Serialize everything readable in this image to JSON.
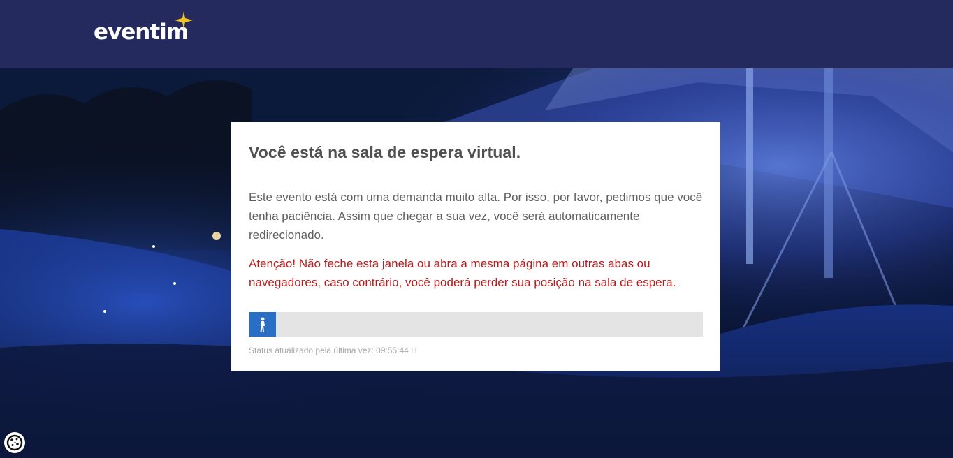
{
  "header": {
    "logo_text": "eventim",
    "background_color": "#242a5e",
    "star_color": "#f3c323"
  },
  "waiting_room": {
    "title": "Você está na sala de espera virtual.",
    "body": "Este evento está com uma demanda muito alta. Por isso, por favor, pedimos que você tenha paciência. Assim que chegar a sua vez, você será automaticamente redirecionado.",
    "warning": "Atenção! Não feche esta janela ou abra a mesma página em outras abas ou navegadores, caso contrário, você poderá perder sua posição na sala de espera.",
    "warning_color": "#b71c1c",
    "progress_fraction": 0.06,
    "progress_color": "#2a6fc4",
    "progress_icon": "walking-person-icon",
    "status_text": "Status atualizado pela última vez: 09:55:44 H"
  },
  "cookie_settings": {
    "icon": "cookie-icon"
  }
}
